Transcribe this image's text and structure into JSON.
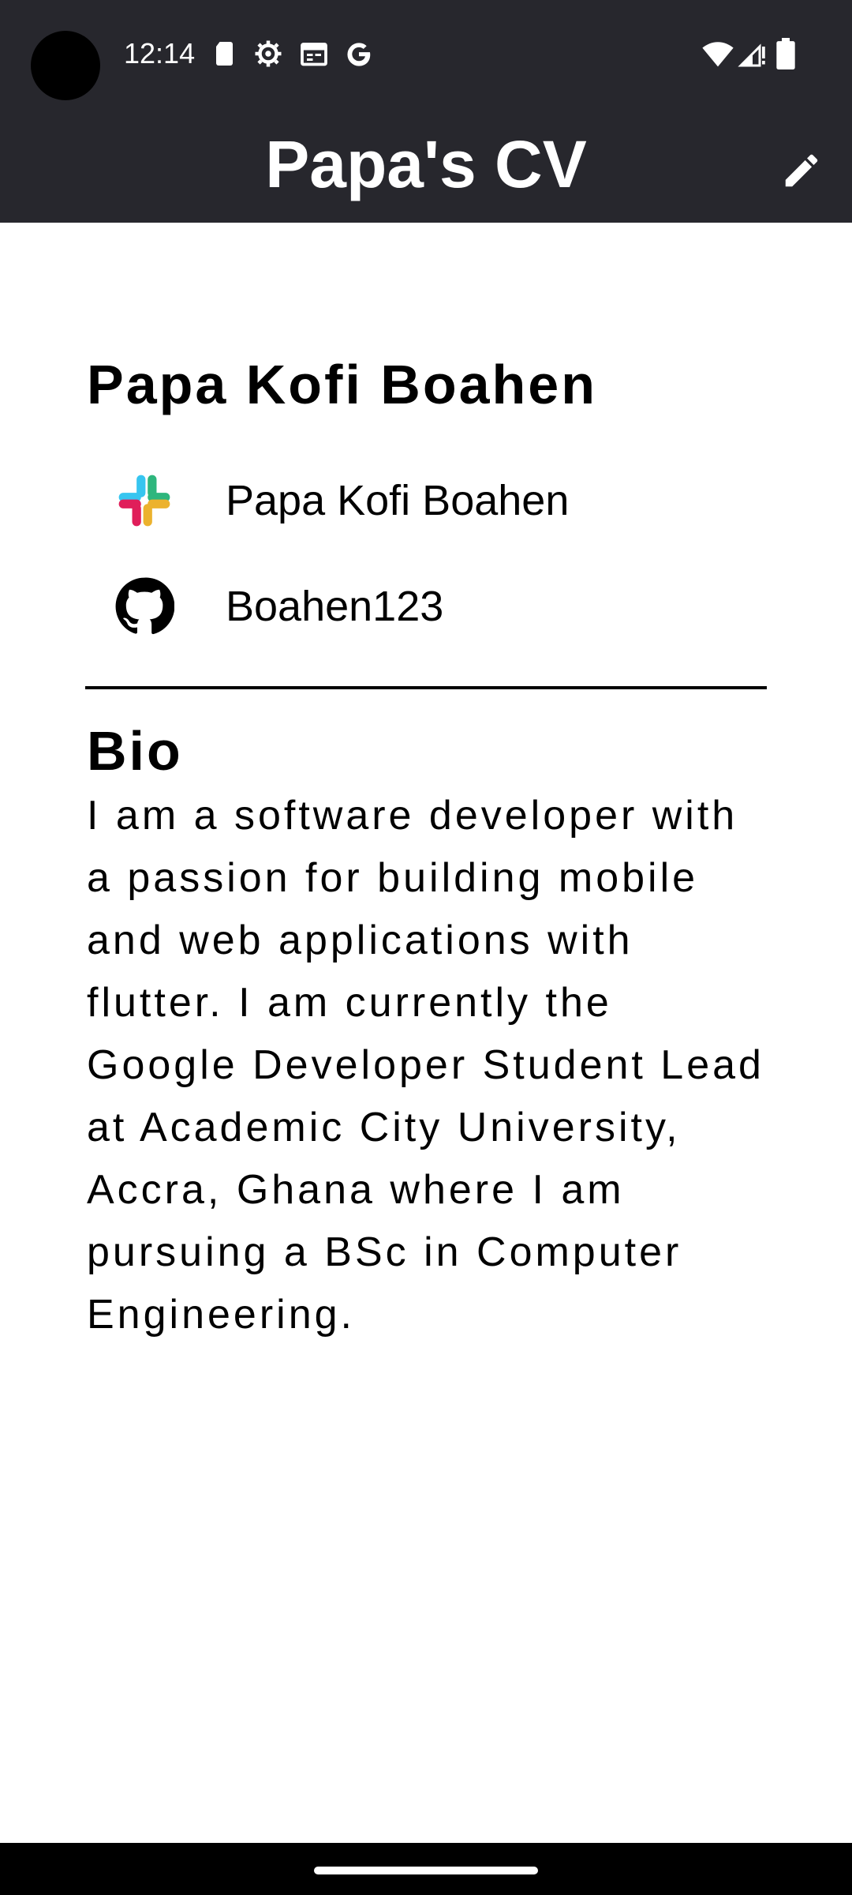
{
  "status_bar": {
    "time": "12:14",
    "left_icons": [
      "sd-card-icon",
      "settings-gear-icon",
      "calendar-icon",
      "google-g-icon"
    ],
    "right_icons": [
      "wifi-icon",
      "cellular-signal-icon",
      "battery-icon"
    ]
  },
  "app_bar": {
    "title": "Papa's CV",
    "action_icon": "edit-pencil-icon",
    "background_color": "#27272d"
  },
  "profile": {
    "name": "Papa Kofi Boahen",
    "contacts": [
      {
        "icon": "slack-icon",
        "label": "Papa Kofi Boahen"
      },
      {
        "icon": "github-icon",
        "label": "Boahen123"
      }
    ]
  },
  "bio": {
    "heading": "Bio",
    "text": "I am a software developer with a passion for building mobile and web applications with flutter. I am currently the Google Developer Student Lead at Academic City University, Accra, Ghana where I am pursuing a BSc in Computer Engineering."
  },
  "nav_bar": {
    "indicator": "home-gesture-bar"
  }
}
